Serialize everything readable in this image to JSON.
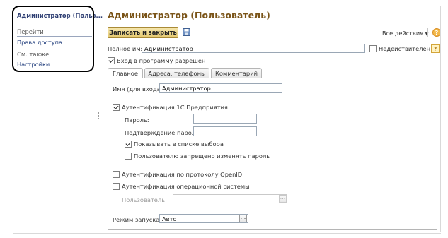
{
  "left_panel": {
    "title": "Администратор (Польз...",
    "goto_label": "Перейти",
    "goto_items": [
      "Права доступа"
    ],
    "see_also_label": "См. также",
    "see_also_items": [
      "Настройки"
    ]
  },
  "header": {
    "title": "Администратор (Пользователь)",
    "save_close_label": "Записать и закрыть",
    "all_actions_label": "Все действия",
    "help_label": "?"
  },
  "form": {
    "full_name_label": "Полное имя:",
    "full_name_value": "Администратор",
    "inactive_label": "Недействителен",
    "inactive_checked": false,
    "inactive_help": "?",
    "login_allowed_label": "Вход в программу разрешен",
    "login_allowed_checked": true
  },
  "tabs": [
    {
      "label": "Главное",
      "active": true
    },
    {
      "label": "Адреса, телефоны",
      "active": false
    },
    {
      "label": "Комментарий",
      "active": false
    }
  ],
  "main_tab": {
    "login_label": "Имя (для входа):",
    "login_value": "Администратор",
    "auth_1c_label": "Аутентификация 1С:Предприятия",
    "auth_1c_checked": true,
    "password_label": "Пароль:",
    "password_value": "",
    "confirm_label": "Подтверждение пароля:",
    "confirm_value": "",
    "show_in_list_label": "Показывать в списке выбора",
    "show_in_list_checked": true,
    "no_change_pass_label": "Пользователю запрещено изменять пароль",
    "no_change_pass_checked": false,
    "openid_label": "Аутентификация по протоколу OpenID",
    "openid_checked": false,
    "os_auth_label": "Аутентификация операционной системы",
    "os_auth_checked": false,
    "user_label": "Пользователь:",
    "user_value": "",
    "launch_mode_label": "Режим запуска:",
    "launch_mode_value": "Авто",
    "more_button": "..."
  },
  "colors": {
    "title": "#7a5418",
    "nav_link": "#1d3a7a",
    "save_button": "#e5c970"
  }
}
